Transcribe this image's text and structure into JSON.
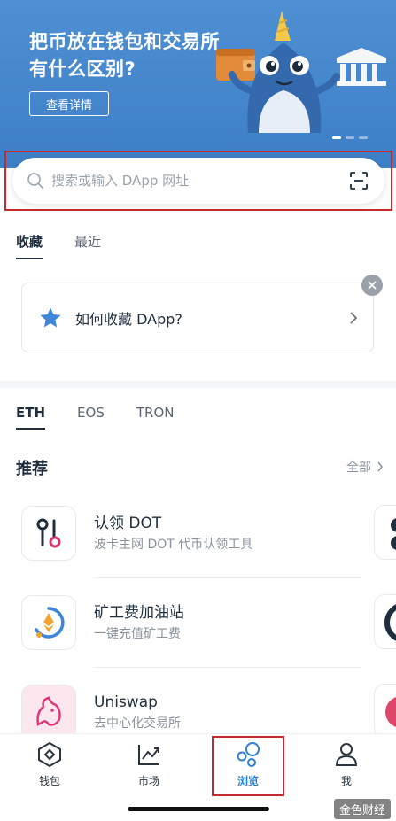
{
  "banner": {
    "title": "把币放在钱包和交易所有什么区别?",
    "button_label": "查看详情",
    "carousel_dots": 3
  },
  "search": {
    "placeholder": "搜索或输入 DApp 网址"
  },
  "top_tabs": [
    {
      "label": "收藏",
      "active": true
    },
    {
      "label": "最近",
      "active": false
    }
  ],
  "favorite_card": {
    "label": "如何收藏 DApp?"
  },
  "chain_tabs": [
    {
      "label": "ETH",
      "active": true
    },
    {
      "label": "EOS",
      "active": false
    },
    {
      "label": "TRON",
      "active": false
    }
  ],
  "recommend": {
    "title": "推荐",
    "all_label": "全部"
  },
  "dapps": [
    {
      "name": "认领 DOT",
      "desc": "波卡主网 DOT 代币认领工具",
      "icon": "dot-claim-icon"
    },
    {
      "name": "矿工费加油站",
      "desc": "一键充值矿工费",
      "icon": "gas-station-icon"
    },
    {
      "name": "Uniswap",
      "desc": "去中心化交易所",
      "icon": "uniswap-unicorn-icon"
    }
  ],
  "bottom_nav": [
    {
      "label": "钱包",
      "icon": "wallet-icon",
      "active": false
    },
    {
      "label": "市场",
      "icon": "market-chart-icon",
      "active": false
    },
    {
      "label": "浏览",
      "icon": "browse-bubbles-icon",
      "active": true
    },
    {
      "label": "我",
      "icon": "profile-icon",
      "active": false
    }
  ],
  "watermark": "金色财经",
  "colors": {
    "banner": "#4f8fd3",
    "accent": "#2f7fd4",
    "highlight_box": "#c7282e",
    "text_primary": "#1f2d3d",
    "text_secondary": "#8a939c"
  }
}
